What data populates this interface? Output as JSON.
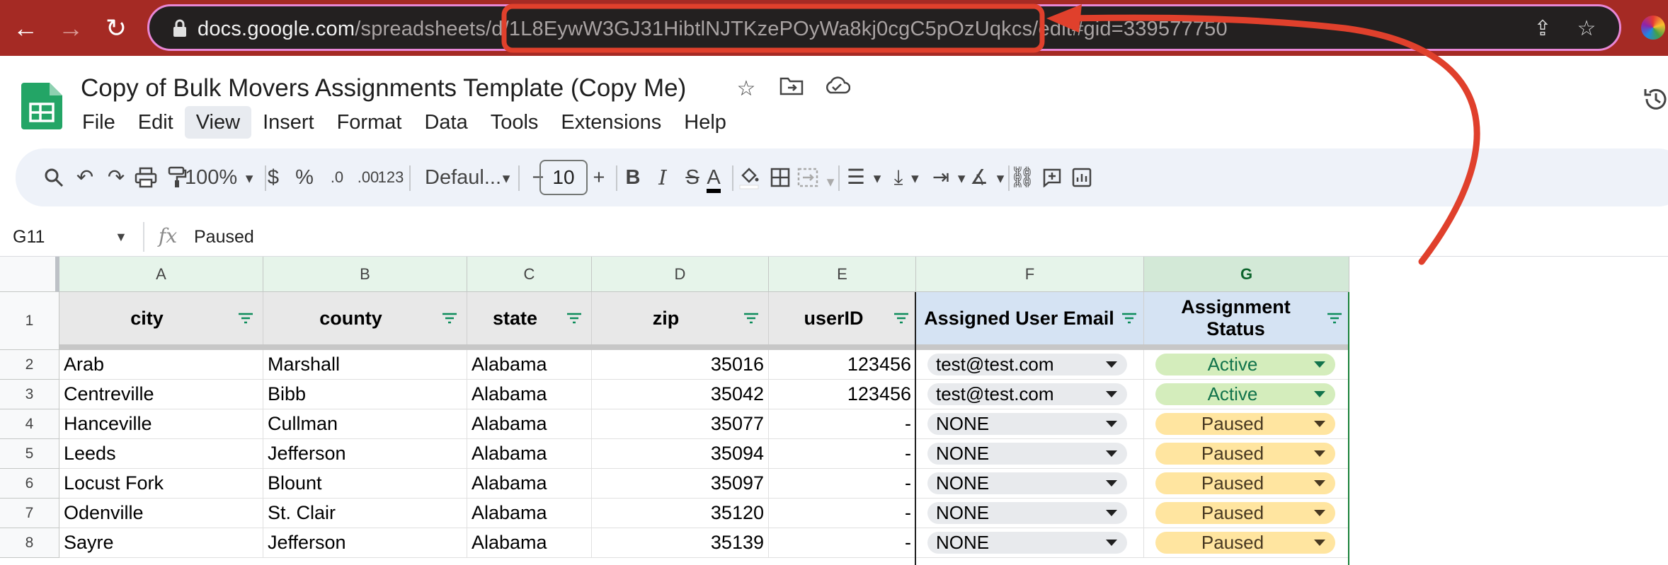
{
  "browser": {
    "url_host": "docs.google.com",
    "url_path_before": "/spreadsheets/d/",
    "url_id": "1L8EywW3GJ31HibtlNJTKzePOyWa8kj0cgC5pOzUqkcs",
    "url_path_after": "/edit#gid=339577750"
  },
  "app": {
    "title": "Copy of Bulk Movers Assignments Template (Copy Me)",
    "menu": [
      "File",
      "Edit",
      "View",
      "Insert",
      "Format",
      "Data",
      "Tools",
      "Extensions",
      "Help"
    ],
    "active_menu": "View"
  },
  "toolbar": {
    "zoom": "100%",
    "currency": "$",
    "percent": "%",
    "decrease_decimal": ".0",
    "increase_decimal": ".00",
    "number_format": "123",
    "font": "Defaul...",
    "font_size": "10",
    "minus": "−",
    "plus": "+",
    "bold": "B",
    "italic": "I",
    "text_color_glyph": "A"
  },
  "formula_bar": {
    "cell_ref": "G11",
    "fx": "fx",
    "value": "Paused"
  },
  "sheet": {
    "columns": [
      "A",
      "B",
      "C",
      "D",
      "E",
      "F",
      "G"
    ],
    "selected_column": "G",
    "header_row_number": "1",
    "headers": [
      "city",
      "county",
      "state",
      "zip",
      "userID",
      "Assigned User Email",
      "Assignment Status"
    ],
    "rows": [
      {
        "n": "2",
        "city": "Arab",
        "county": "Marshall",
        "state": "Alabama",
        "zip": "35016",
        "userID": "123456",
        "email": "test@test.com",
        "status": "Active"
      },
      {
        "n": "3",
        "city": "Centreville",
        "county": "Bibb",
        "state": "Alabama",
        "zip": "35042",
        "userID": "123456",
        "email": "test@test.com",
        "status": "Active"
      },
      {
        "n": "4",
        "city": "Hanceville",
        "county": "Cullman",
        "state": "Alabama",
        "zip": "35077",
        "userID": "-",
        "email": "NONE",
        "status": "Paused"
      },
      {
        "n": "5",
        "city": "Leeds",
        "county": "Jefferson",
        "state": "Alabama",
        "zip": "35094",
        "userID": "-",
        "email": "NONE",
        "status": "Paused"
      },
      {
        "n": "6",
        "city": "Locust Fork",
        "county": "Blount",
        "state": "Alabama",
        "zip": "35097",
        "userID": "-",
        "email": "NONE",
        "status": "Paused"
      },
      {
        "n": "7",
        "city": "Odenville",
        "county": "St. Clair",
        "state": "Alabama",
        "zip": "35120",
        "userID": "-",
        "email": "NONE",
        "status": "Paused"
      },
      {
        "n": "8",
        "city": "Sayre",
        "county": "Jefferson",
        "state": "Alabama",
        "zip": "35139",
        "userID": "-",
        "email": "NONE",
        "status": "Paused"
      }
    ]
  },
  "annotation": {
    "color": "#e0402c"
  }
}
